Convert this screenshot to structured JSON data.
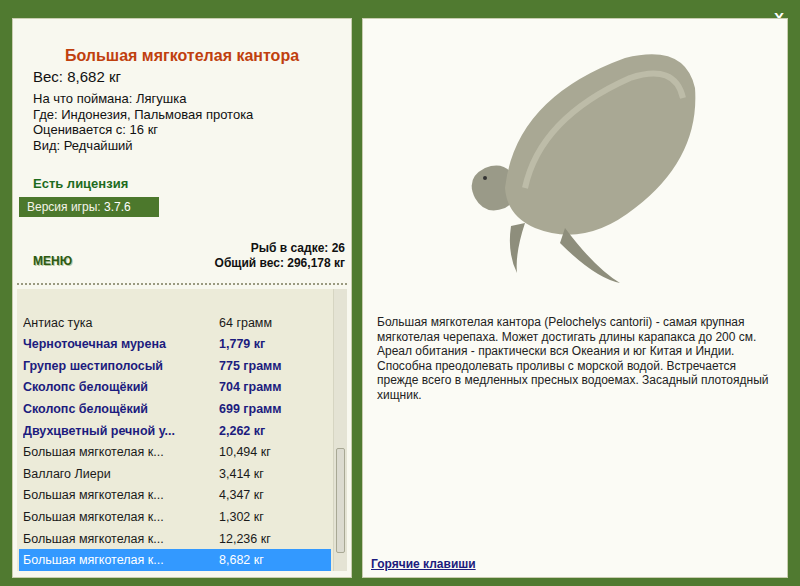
{
  "window": {
    "close": "X"
  },
  "fish": {
    "title": "Большая мягкотелая кантора",
    "weight": "Вес: 8,682 кг",
    "details": [
      "На что поймана: Лягушка",
      "Где: Индонезия, Пальмовая протока",
      "Оценивается с: 16 кг",
      "Вид: Редчайший"
    ],
    "license": "Есть лицензия",
    "version_label": "Версия игры:",
    "version": "3.7.6"
  },
  "menu_button": "МЕНЮ",
  "stats": [
    "Рыб в садке: 26",
    "Общий вес: 296,178 кг"
  ],
  "catch_list": [
    {
      "name": "Антиас тука",
      "weight": "64 грамм",
      "rare": false,
      "selected": false
    },
    {
      "name": "Черноточечная мурена",
      "weight": "1,779 кг",
      "rare": true,
      "selected": false
    },
    {
      "name": "Групер шестиполосый",
      "weight": "775 грамм",
      "rare": true,
      "selected": false
    },
    {
      "name": "Сколопс белощёкий",
      "weight": "704 грамм",
      "rare": true,
      "selected": false
    },
    {
      "name": "Сколопс белощёкий",
      "weight": "699 грамм",
      "rare": true,
      "selected": false
    },
    {
      "name": "Двухцветный речной у...",
      "weight": "2,262 кг",
      "rare": true,
      "selected": false
    },
    {
      "name": "Большая мягкотелая к...",
      "weight": "10,494 кг",
      "rare": false,
      "selected": false
    },
    {
      "name": "Валлаго Лиери",
      "weight": "3,414 кг",
      "rare": false,
      "selected": false
    },
    {
      "name": "Большая мягкотелая к...",
      "weight": "4,347 кг",
      "rare": false,
      "selected": false
    },
    {
      "name": "Большая мягкотелая к...",
      "weight": "1,302 кг",
      "rare": false,
      "selected": false
    },
    {
      "name": "Большая мягкотелая к...",
      "weight": "12,236 кг",
      "rare": false,
      "selected": false
    },
    {
      "name": "Большая мягкотелая к...",
      "weight": "8,682 кг",
      "rare": false,
      "selected": true
    }
  ],
  "scrollbar": {
    "level": 0.9
  },
  "description": "Большая мягкотелая кантора (Pelochelys cantorii) - самая крупная мягкотелая черепаха. Может достигать длины карапакса до 200 см. Ареал обитания - практически вся Океания и юг Китая и Индии. Способна преодолевать проливы с морской водой. Встречается прежде всего в медленных пресных водоемах. Засадный плотоядный хищник.",
  "hotkeys": "Горячие клавиши"
}
